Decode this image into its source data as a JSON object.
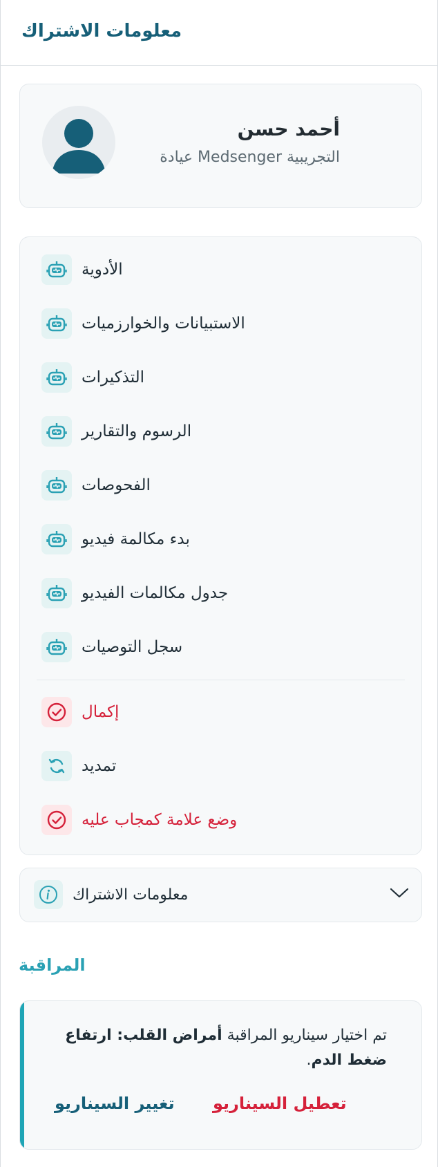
{
  "header": {
    "title": "معلومات الاشتراك"
  },
  "profile": {
    "name": "أحمد حسن",
    "subtitle": "التجريبية Medsenger عيادة"
  },
  "menu": {
    "items": [
      {
        "label": "الأدوية",
        "icon": "robot-icon"
      },
      {
        "label": "الاستبيانات والخوارزميات",
        "icon": "robot-icon"
      },
      {
        "label": "التذكيرات",
        "icon": "robot-icon"
      },
      {
        "label": "الرسوم والتقارير",
        "icon": "robot-icon"
      },
      {
        "label": "الفحوصات",
        "icon": "robot-icon"
      },
      {
        "label": "بدء مكالمة فيديو",
        "icon": "robot-icon"
      },
      {
        "label": "جدول مكالمات الفيديو",
        "icon": "robot-icon"
      },
      {
        "label": "سجل التوصيات",
        "icon": "robot-icon"
      }
    ],
    "actions": [
      {
        "label": "إكمال",
        "icon": "check-circle-icon"
      },
      {
        "label": "تمديد",
        "icon": "refresh-icon"
      },
      {
        "label": "وضع علامة كمجاب عليه",
        "icon": "check-circle-icon"
      }
    ]
  },
  "subscription_info": {
    "label": "معلومات الاشتراك"
  },
  "monitoring": {
    "title": "المراقبة",
    "text_prefix": "تم اختيار سيناريو المراقبة ",
    "scenario": "أمراض القلب: ارتفاع ضغط الدم",
    "text_suffix": ".",
    "change_label": "تغيير السيناريو",
    "disable_label": "تعطيل السيناريو"
  },
  "colors": {
    "brand": "#165f78",
    "accent": "#2aa1b4",
    "danger": "#d5213a",
    "icon_bg": "#e4f3f3"
  }
}
